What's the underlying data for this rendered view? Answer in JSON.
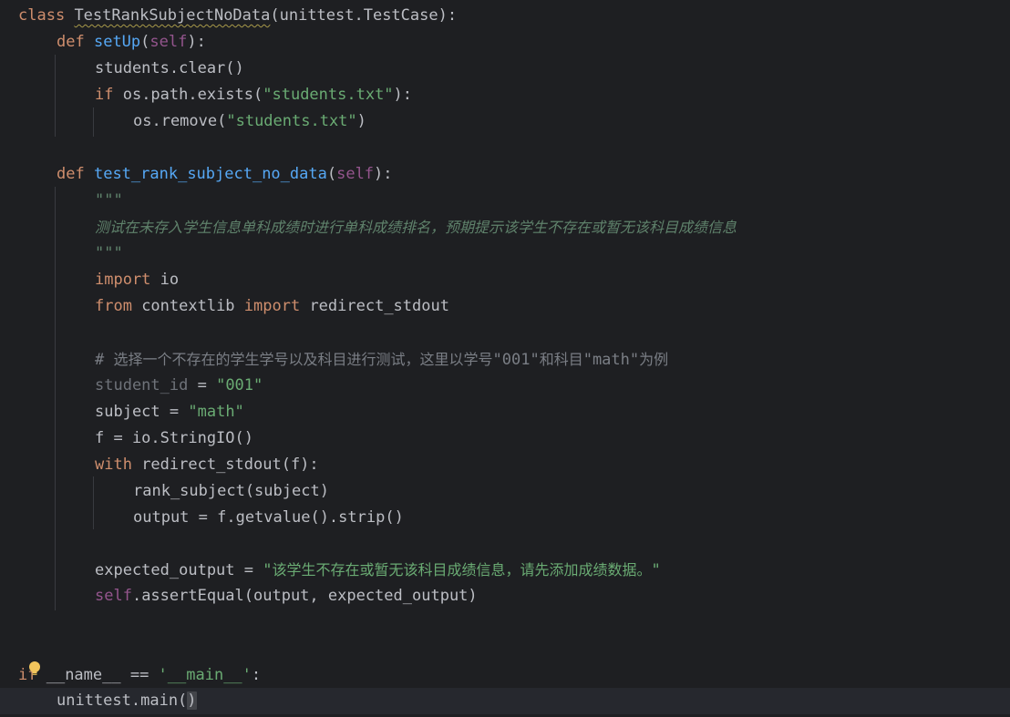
{
  "colors": {
    "background": "#1e1f22",
    "keyword": "#cf8e6d",
    "function": "#56a8f5",
    "self": "#94558d",
    "string": "#6aab73",
    "docstring": "#5f826b",
    "comment": "#7a7e85",
    "text": "#bcbec4"
  },
  "code": {
    "l1": {
      "kw": "class",
      "name": "TestRankSubjectNoData",
      "rest": "(unittest.TestCase):"
    },
    "l2": {
      "kw": "def",
      "fn": "setUp",
      "open": "(",
      "self": "self",
      "close": "):"
    },
    "l3": {
      "text": "students.clear()"
    },
    "l4": {
      "kw": "if",
      "a": " os.path.exists(",
      "str": "\"students.txt\"",
      "b": "):"
    },
    "l5": {
      "a": "os.remove(",
      "str": "\"students.txt\"",
      "b": ")"
    },
    "l7": {
      "kw": "def",
      "fn": "test_rank_subject_no_data",
      "open": "(",
      "self": "self",
      "close": "):"
    },
    "l8": {
      "text": "\"\"\""
    },
    "l9": {
      "text": "测试在未存入学生信息单科成绩时进行单科成绩排名，预期提示该学生不存在或暂无该科目成绩信息"
    },
    "l10": {
      "text": "\"\"\""
    },
    "l11": {
      "kw": "import",
      "rest": " io"
    },
    "l12": {
      "kw1": "from",
      "mid": " contextlib ",
      "kw2": "import",
      "rest": " redirect_stdout"
    },
    "l14": {
      "hash": "# ",
      "a": "选择一个不存在的学生学号以及科目进行测试，这里以学号",
      "q1": "\"001\"",
      "b": "和科目",
      "q2": "\"math\"",
      "c": "为例"
    },
    "l15": {
      "var": "student_id",
      "eq": " = ",
      "str": "\"001\""
    },
    "l16": {
      "var": "subject",
      "eq": " = ",
      "str": "\"math\""
    },
    "l17": {
      "text": "f = io.StringIO()"
    },
    "l18": {
      "kw": "with",
      "rest": " redirect_stdout(f):"
    },
    "l19": {
      "text": "rank_subject(subject)"
    },
    "l20": {
      "text": "output = f.getvalue().strip()"
    },
    "l22": {
      "var": "expected_output = ",
      "q": "\"",
      "str": "该学生不存在或暂无该科目成绩信息，请先添加成绩数据。",
      "q2": "\""
    },
    "l23": {
      "self": "self",
      "rest": ".assertEqual(output, expected_output)"
    },
    "l26": {
      "kw": "if",
      "a": " __name__ == ",
      "str": "'__main__'",
      "b": ":"
    },
    "l27": {
      "a": "unittest.main(",
      "b": ")"
    }
  }
}
